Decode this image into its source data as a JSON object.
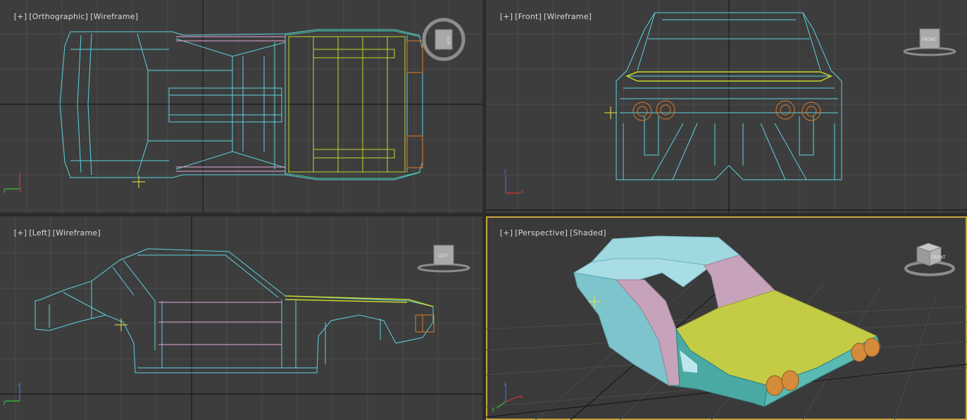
{
  "viewports": {
    "top": {
      "plus": "[+]",
      "view": "[Orthographic]",
      "mode": "[Wireframe]",
      "cube_label": "TOP"
    },
    "front": {
      "plus": "[+]",
      "view": "[Front]",
      "mode": "[Wireframe]",
      "cube_label": "FRONT"
    },
    "left": {
      "plus": "[+]",
      "view": "[Left]",
      "mode": "[Wireframe]",
      "cube_label": "LEFT"
    },
    "perspective": {
      "plus": "[+]",
      "view": "[Perspective]",
      "mode": "[Shaded]",
      "cube_label": "FRONT"
    }
  },
  "axes": {
    "x": "x",
    "y": "y",
    "z": "z"
  },
  "colors": {
    "viewport_bg": "#3d3d3d",
    "wire_body": "#5ad3e0",
    "wire_pink": "#e7a7d8",
    "wire_yellow": "#c8d52a",
    "wire_orange": "#e07a2a",
    "active_border": "#c9a53f"
  },
  "active_viewport": "perspective"
}
